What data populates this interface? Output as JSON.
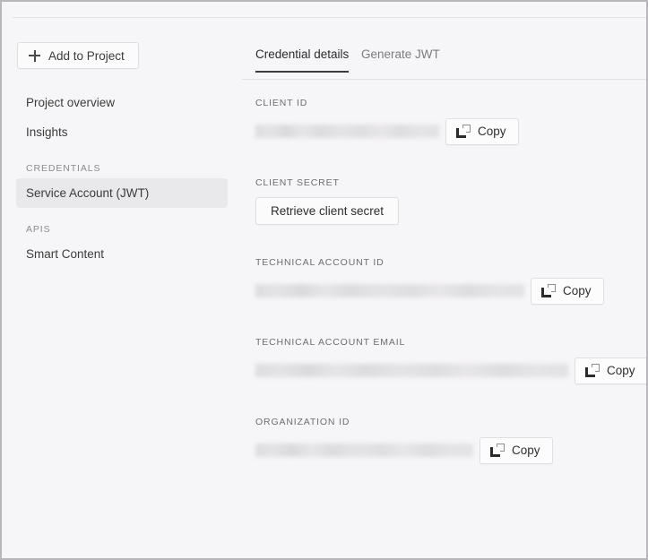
{
  "sidebar": {
    "add_button": {
      "label": "Add to Project",
      "icon": "plus-icon"
    },
    "nav": [
      {
        "label": "Project overview",
        "type": "item",
        "selected": false
      },
      {
        "label": "Insights",
        "type": "item",
        "selected": false
      },
      {
        "label": "CREDENTIALS",
        "type": "section"
      },
      {
        "label": "Service Account (JWT)",
        "type": "item",
        "selected": true
      },
      {
        "label": "APIS",
        "type": "section"
      },
      {
        "label": "Smart Content",
        "type": "item",
        "selected": false
      }
    ]
  },
  "main": {
    "tabs": [
      {
        "label": "Credential details",
        "active": true
      },
      {
        "label": "Generate JWT",
        "active": false
      }
    ],
    "fields": [
      {
        "label": "CLIENT ID",
        "kind": "redacted-copy",
        "value": "",
        "value_redacted": true,
        "redacted_width": 205,
        "copy_label": "Copy",
        "copy_icon": "copy-icon"
      },
      {
        "label": "CLIENT SECRET",
        "kind": "button",
        "button_label": "Retrieve client secret"
      },
      {
        "label": "TECHNICAL ACCOUNT ID",
        "kind": "redacted-copy",
        "value": "",
        "value_redacted": true,
        "redacted_width": 300,
        "copy_label": "Copy",
        "copy_icon": "copy-icon"
      },
      {
        "label": "TECHNICAL ACCOUNT EMAIL",
        "kind": "redacted-copy",
        "value": "",
        "value_redacted": true,
        "redacted_width": 349,
        "copy_label": "Copy",
        "copy_icon": "copy-icon"
      },
      {
        "label": "ORGANIZATION ID",
        "kind": "redacted-copy",
        "value": "",
        "value_redacted": true,
        "redacted_width": 243,
        "copy_label": "Copy",
        "copy_icon": "copy-icon"
      }
    ]
  },
  "colors": {
    "page_background": "#f6f5f7",
    "selected_item_background": "#e9e8ea",
    "active_tab_underline": "#3a3a3a",
    "text_primary": "#3c3c3c",
    "text_muted": "#8d8b90",
    "border": "#e2e0e4",
    "frame_border": "#b9b6bb"
  }
}
